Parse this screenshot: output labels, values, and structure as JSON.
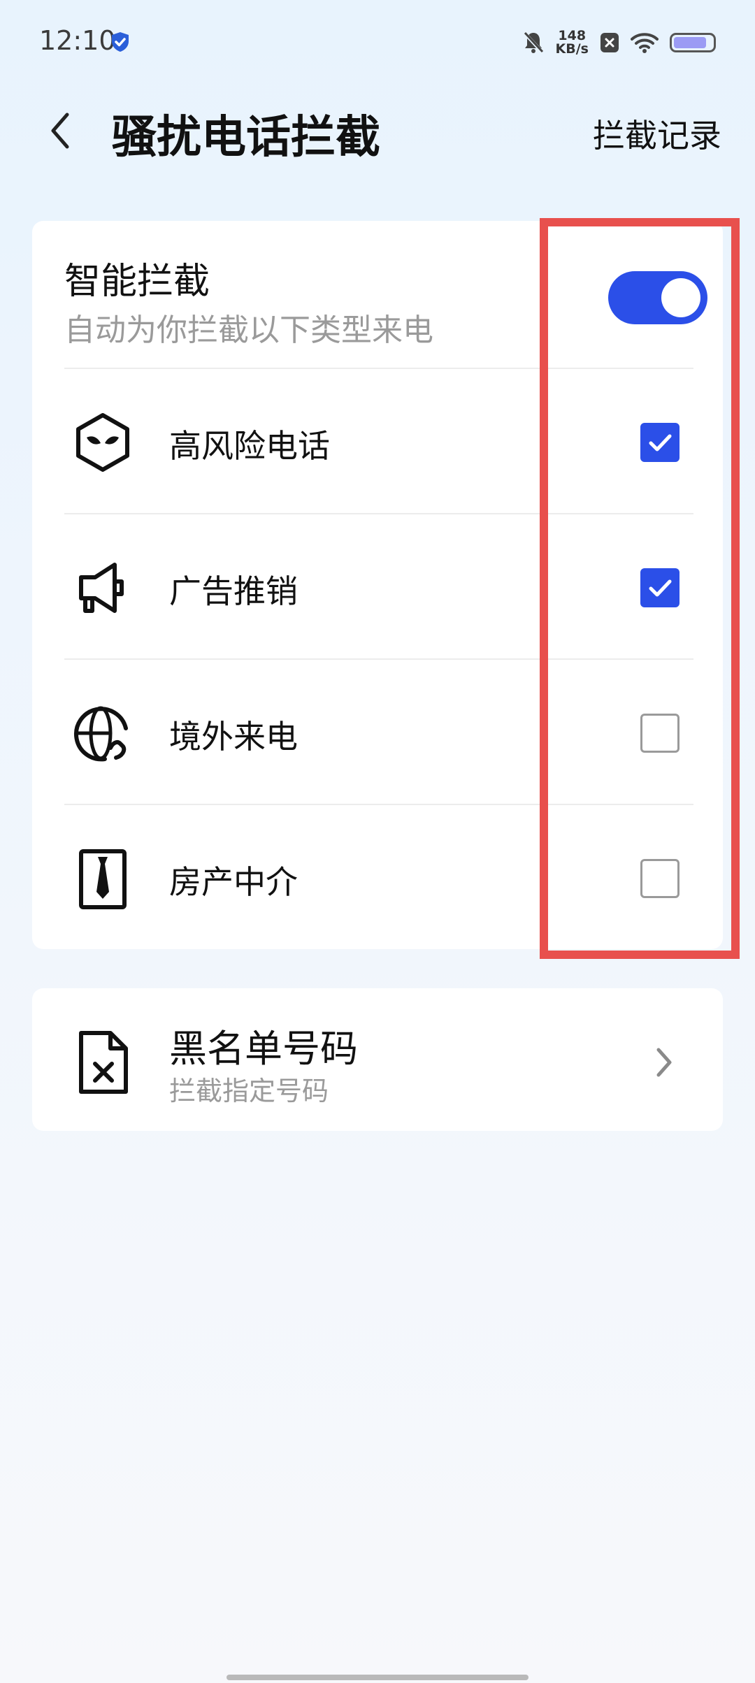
{
  "status_bar": {
    "time": "12:10",
    "net_speed_value": "148",
    "net_speed_unit": "KB/s",
    "icons": [
      "shield-check-icon",
      "bell-off-icon",
      "close-box-icon",
      "wifi-icon",
      "battery-icon"
    ],
    "battery_level": 0.8
  },
  "header": {
    "back_icon": "chevron-left-icon",
    "title": "骚扰电话拦截",
    "records_label": "拦截记录"
  },
  "smart_block": {
    "title": "智能拦截",
    "subtitle": "自动为你拦截以下类型来电",
    "enabled": true,
    "accent_color": "#2b4fe8",
    "categories": [
      {
        "label": "高风险电话",
        "icon": "masked-face-hexagon-icon",
        "checked": true
      },
      {
        "label": "广告推销",
        "icon": "megaphone-icon",
        "checked": true
      },
      {
        "label": "境外来电",
        "icon": "globe-phone-icon",
        "checked": false
      },
      {
        "label": "房产中介",
        "icon": "necktie-badge-icon",
        "checked": false
      }
    ]
  },
  "blacklist": {
    "title": "黑名单号码",
    "subtitle": "拦截指定号码",
    "icon": "file-x-icon",
    "chevron_icon": "chevron-right-icon"
  },
  "annotation": {
    "highlight_color": "#e8504d"
  }
}
